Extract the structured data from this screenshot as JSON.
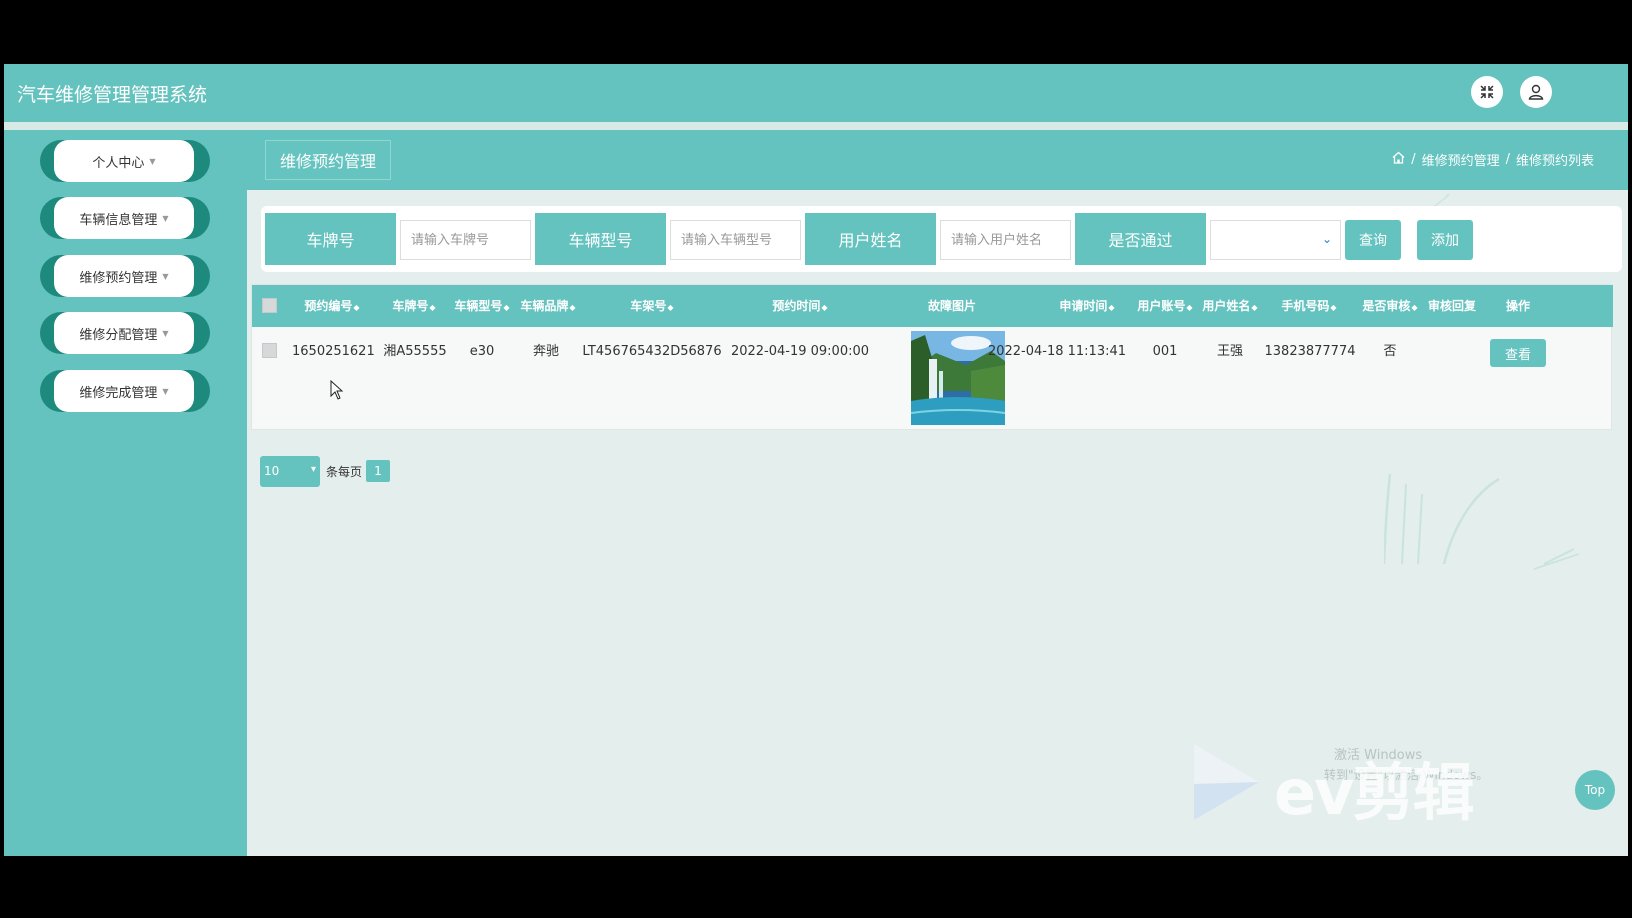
{
  "app": {
    "title": "汽车维修管理管理系统"
  },
  "header": {
    "fullscreen_icon": "fullscreen-exit-icon",
    "user_icon": "user-icon"
  },
  "sidebar": {
    "items": [
      {
        "label": "个人中心"
      },
      {
        "label": "车辆信息管理"
      },
      {
        "label": "维修预约管理"
      },
      {
        "label": "维修分配管理"
      },
      {
        "label": "维修完成管理"
      }
    ]
  },
  "page": {
    "tab_title": "维修预约管理",
    "breadcrumb": [
      "维修预约管理",
      "维修预约列表"
    ],
    "breadcrumb_sep": "/"
  },
  "search": {
    "plate_label": "车牌号",
    "plate_placeholder": "请输入车牌号",
    "model_label": "车辆型号",
    "model_placeholder": "请输入车辆型号",
    "name_label": "用户姓名",
    "name_placeholder": "请输入用户姓名",
    "passed_label": "是否通过",
    "passed_value": "",
    "query_button": "查询",
    "add_button": "添加"
  },
  "table": {
    "columns": [
      "预约编号",
      "车牌号",
      "车辆型号",
      "车辆品牌",
      "车架号",
      "预约时间",
      "故障图片",
      "申请时间",
      "用户账号",
      "用户姓名",
      "手机号码",
      "是否审核",
      "审核回复",
      "操作"
    ],
    "rows": [
      {
        "booking_no": "1650251621",
        "plate": "湘A55555",
        "model": "e30",
        "brand": "奔驰",
        "vin": "LT456765432D56876",
        "booking_time": "2022-04-19 09:00:00",
        "apply_time": "2022-04-18 11:13:41",
        "account": "001",
        "user_name": "王强",
        "phone": "13823877774",
        "reviewed": "否",
        "reply": "",
        "action": "查看"
      }
    ]
  },
  "pagination": {
    "page_size": "10",
    "per_page_label": "条每页",
    "current_page": "1"
  },
  "overlays": {
    "top_button": "Top",
    "activate_windows_line1": "激活 Windows",
    "activate_windows_line2": "转到\"设置\"以激活 Windows。",
    "watermark_text": "ev剪辑"
  },
  "colors": {
    "primary": "#64c3bf",
    "sidebar_pill": "#1e8a7e",
    "content_bg": "#e4eeec"
  }
}
